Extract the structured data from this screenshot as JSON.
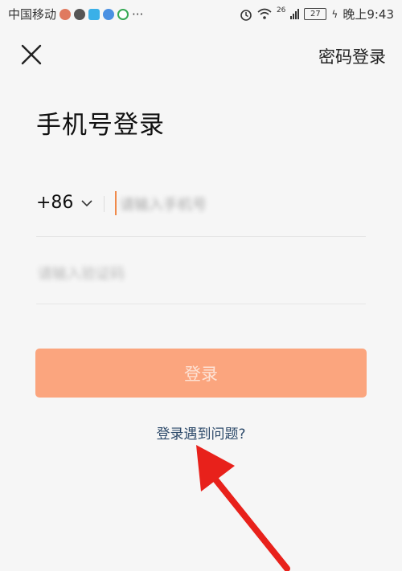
{
  "status_bar": {
    "carrier": "中国移动",
    "more": "···",
    "network_label": "26",
    "battery": "27",
    "time": "晚上9:43"
  },
  "nav": {
    "close_icon": "close-icon",
    "password_login": "密码登录"
  },
  "title": "手机号登录",
  "phone": {
    "country_code": "+86",
    "placeholder": "请输入手机号"
  },
  "code": {
    "placeholder": "请输入验证码"
  },
  "login_button": "登录",
  "trouble_link": "登录遇到问题?",
  "colors": {
    "accent": "#fba57e",
    "caret": "#f08a4b",
    "link": "#2d4a6a",
    "annotation_arrow": "#e8211b"
  }
}
